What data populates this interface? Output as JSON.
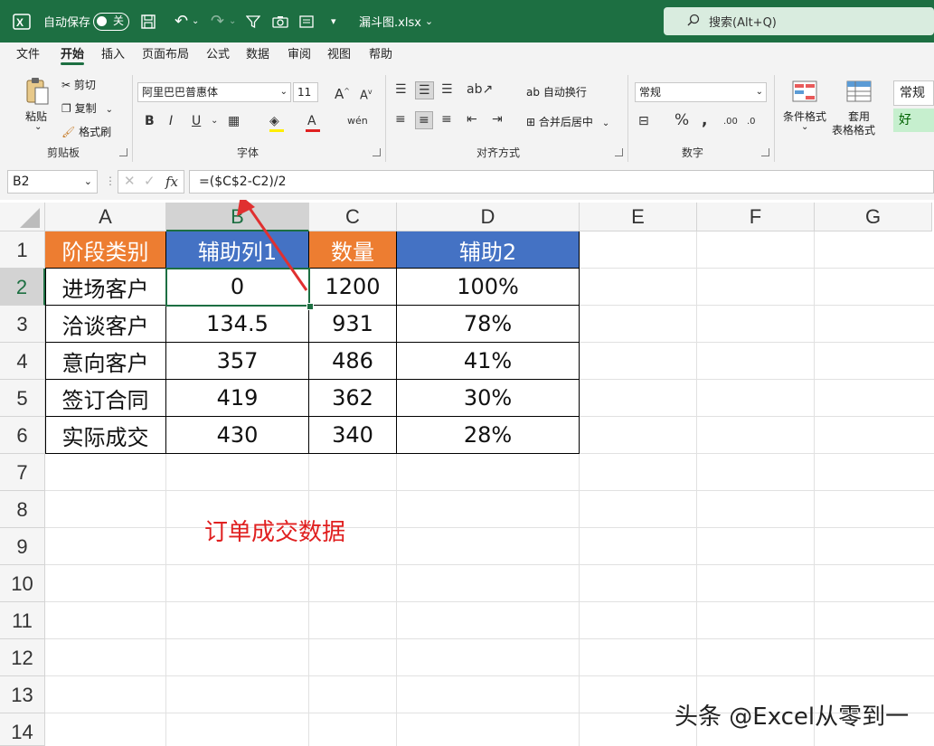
{
  "titlebar": {
    "autosave_label": "自动保存",
    "autosave_state": "关",
    "filename": "漏斗图.xlsx",
    "search_placeholder": "搜索(Alt+Q)"
  },
  "menu": [
    "文件",
    "开始",
    "插入",
    "页面布局",
    "公式",
    "数据",
    "审阅",
    "视图",
    "帮助"
  ],
  "ribbon": {
    "clipboard": {
      "paste": "粘贴",
      "cut": "剪切",
      "copy": "复制",
      "format_painter": "格式刷",
      "group": "剪贴板"
    },
    "font": {
      "name": "阿里巴巴普惠体",
      "size": "11",
      "group": "字体"
    },
    "alignment": {
      "wrap": "自动换行",
      "merge": "合并后居中",
      "group": "对齐方式"
    },
    "number": {
      "format": "常规",
      "group": "数字"
    },
    "styles": {
      "conditional": "条件格式",
      "table_format_1": "套用",
      "table_format_2": "表格格式",
      "style_normal": "常规",
      "style_good": "好"
    }
  },
  "formula_bar": {
    "name_box": "B2",
    "fx": "fx",
    "formula": "=($C$2-C2)/2"
  },
  "columns": [
    "A",
    "B",
    "C",
    "D",
    "E",
    "F",
    "G"
  ],
  "rows": [
    "1",
    "2",
    "3",
    "4",
    "5",
    "6",
    "7",
    "8",
    "9",
    "10",
    "11",
    "12",
    "13",
    "14"
  ],
  "table": {
    "headers": [
      "阶段类别",
      "辅助列1",
      "数量",
      "辅助2"
    ],
    "rows": [
      [
        "进场客户",
        "0",
        "1200",
        "100%"
      ],
      [
        "洽谈客户",
        "134.5",
        "931",
        "78%"
      ],
      [
        "意向客户",
        "357",
        "486",
        "41%"
      ],
      [
        "签订合同",
        "419",
        "362",
        "30%"
      ],
      [
        "实际成交",
        "430",
        "340",
        "28%"
      ]
    ]
  },
  "note": "订单成交数据",
  "watermark": "头条 @Excel从零到一",
  "colors": {
    "excel_green": "#1d6f42",
    "header_orange": "#ed7d31",
    "header_blue": "#4472c4",
    "note_red": "#e02020"
  }
}
